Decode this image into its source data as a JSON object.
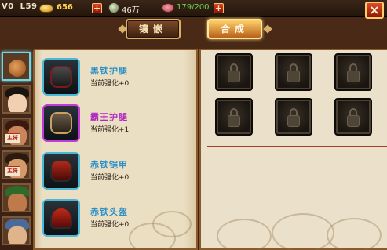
{
  "topbar": {
    "vip": "V0",
    "level": "L59",
    "gold": "656",
    "coins": "46万",
    "stamina": "179/200",
    "plus": "+"
  },
  "tabs": [
    {
      "label": "镶嵌",
      "active": false
    },
    {
      "label": "合成",
      "active": true
    }
  ],
  "close_label": "×",
  "heroes": [
    {
      "name": "bag",
      "selected": true
    },
    {
      "name": "hero-2",
      "selected": false
    },
    {
      "name": "hero-3",
      "tag": "主将",
      "selected": false
    },
    {
      "name": "hero-4",
      "tag": "主将",
      "selected": false
    },
    {
      "name": "hero-5",
      "selected": false
    },
    {
      "name": "hero-6",
      "selected": false
    }
  ],
  "equipment": [
    {
      "name": "黑铁护腿",
      "enhance": "当前强化+0",
      "color": "#2a8fc6",
      "frame": "blue"
    },
    {
      "name": "霸王护腿",
      "enhance": "当前强化+1",
      "color": "#b02ac0",
      "frame": "purple"
    },
    {
      "name": "赤铁铠甲",
      "enhance": "当前强化+0",
      "color": "#2a8fc6",
      "frame": "blue"
    },
    {
      "name": "赤铁头盔",
      "enhance": "当前强化+0",
      "color": "#2a8fc6",
      "frame": "blue"
    }
  ],
  "slots": [
    "locked",
    "locked",
    "locked",
    "locked",
    "locked",
    "locked"
  ]
}
